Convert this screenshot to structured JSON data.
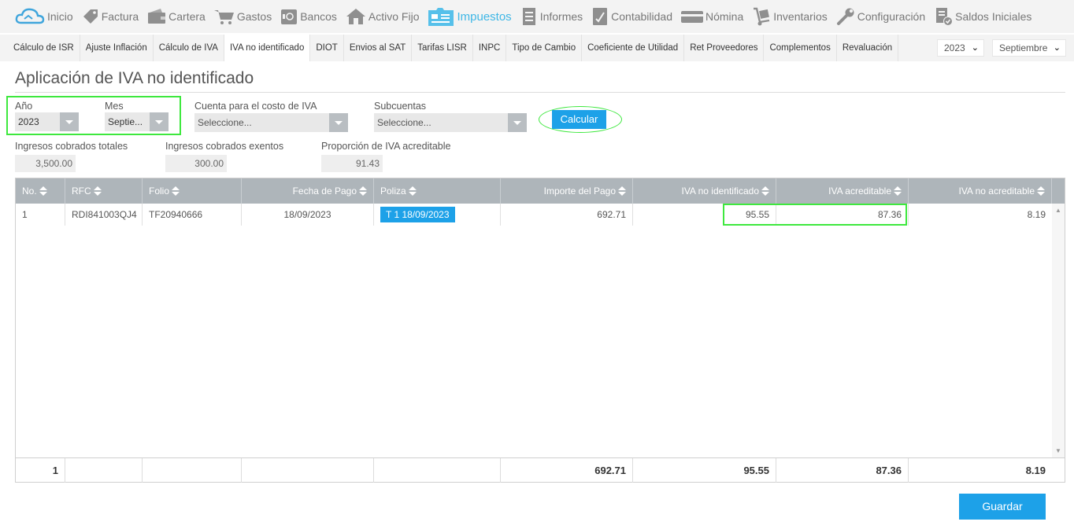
{
  "nav": {
    "items": [
      {
        "label": "Inicio",
        "icon": "cloud-icon"
      },
      {
        "label": "Factura",
        "icon": "tag-icon"
      },
      {
        "label": "Cartera",
        "icon": "wallet-icon"
      },
      {
        "label": "Gastos",
        "icon": "cart-icon"
      },
      {
        "label": "Bancos",
        "icon": "safe-icon"
      },
      {
        "label": "Activo Fijo",
        "icon": "house-icon"
      },
      {
        "label": "Impuestos",
        "icon": "tax-folder-icon"
      },
      {
        "label": "Informes",
        "icon": "report-icon"
      },
      {
        "label": "Contabilidad",
        "icon": "ledger-icon"
      },
      {
        "label": "Nómina",
        "icon": "card-icon"
      },
      {
        "label": "Inventarios",
        "icon": "dolly-icon"
      },
      {
        "label": "Configuración",
        "icon": "wrench-icon"
      },
      {
        "label": "Saldos Iniciales",
        "icon": "doc-check-icon"
      }
    ],
    "active_index": 6,
    "active_color": "#3fb7e6"
  },
  "tabs": {
    "items": [
      "Cálculo de ISR",
      "Ajuste Inflación",
      "Cálculo de IVA",
      "IVA no identificado",
      "DIOT",
      "Envios al SAT",
      "Tarifas LISR",
      "INPC",
      "Tipo de Cambio",
      "Coeficiente de Utilidad",
      "Ret Proveedores",
      "Complementos",
      "Revaluación"
    ],
    "active_index": 3,
    "year_select": "2023",
    "month_select": "Septiembre"
  },
  "page": {
    "title": "Aplicación de IVA no identificado"
  },
  "filters": {
    "year_label": "Año",
    "year_value": "2023",
    "month_label": "Mes",
    "month_value": "Septie...",
    "cuenta_label": "Cuenta para el costo de IVA",
    "cuenta_placeholder": "Seleccione...",
    "subcuentas_label": "Subcuentas",
    "subcuentas_placeholder": "Seleccione...",
    "calcular_label": "Calcular"
  },
  "summary": {
    "ingresos_totales_label": "Ingresos cobrados totales",
    "ingresos_totales_value": "3,500.00",
    "ingresos_exentos_label": "Ingresos cobrados exentos",
    "ingresos_exentos_value": "300.00",
    "proporcion_label": "Proporción de IVA acreditable",
    "proporcion_value": "91.43"
  },
  "table": {
    "headers": [
      "No.",
      "RFC",
      "Folio",
      "Fecha de Pago",
      "Poliza",
      "Importe del Pago",
      "IVA no identificado",
      "IVA acreditable",
      "IVA no acreditable"
    ],
    "rows": [
      {
        "no": "1",
        "rfc": "RDI841003QJ4",
        "folio": "TF20940666",
        "fecha": "18/09/2023",
        "poliza": "T 1 18/09/2023",
        "importe": "692.71",
        "iva_no_identificado": "95.55",
        "iva_acreditable": "87.36",
        "iva_no_acreditable": "8.19"
      }
    ],
    "footer": {
      "count": "1",
      "importe": "692.71",
      "iva_no_identificado": "95.55",
      "iva_acreditable": "87.36",
      "iva_no_acreditable": "8.19"
    }
  },
  "actions": {
    "guardar_label": "Guardar"
  },
  "colors": {
    "accent": "#1da1e8",
    "highlight": "#3ee83e",
    "header_bg": "#aeb5ba"
  }
}
